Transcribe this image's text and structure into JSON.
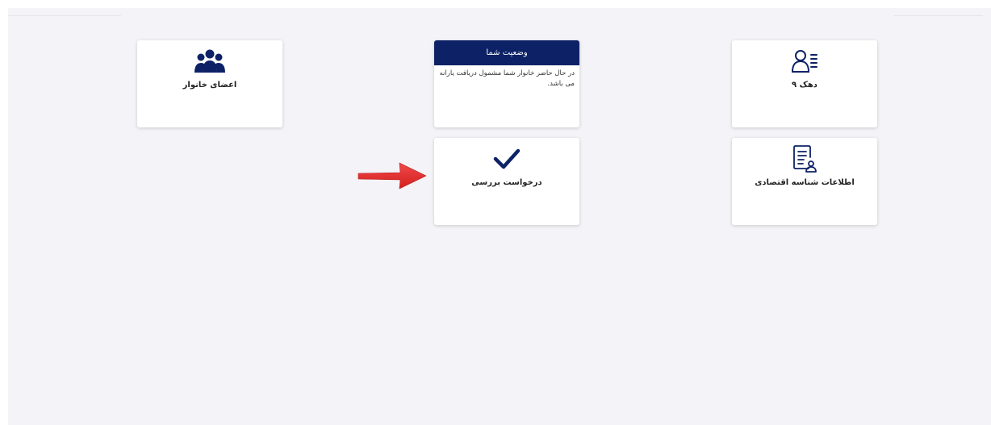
{
  "colors": {
    "navy": "#0d2266",
    "background": "#f4f3f7",
    "arrow": "#e32b2b"
  },
  "cards": {
    "family_members": {
      "label": "اعضای خانوار",
      "icon": "users-group-icon"
    },
    "status": {
      "title": "وضعیت شما",
      "text": "در حال حاضر خانوار شما مشمول دریافت یارانه می باشد."
    },
    "decile": {
      "label": "دهک ۹",
      "icon": "user-list-icon"
    },
    "review_request": {
      "label": "درخواست بررسی",
      "icon": "checkmark-icon"
    },
    "economic_id": {
      "label": "اطلاعات شناسه اقتصادی",
      "icon": "document-user-icon"
    }
  },
  "annotation": {
    "icon": "red-arrow-icon"
  }
}
